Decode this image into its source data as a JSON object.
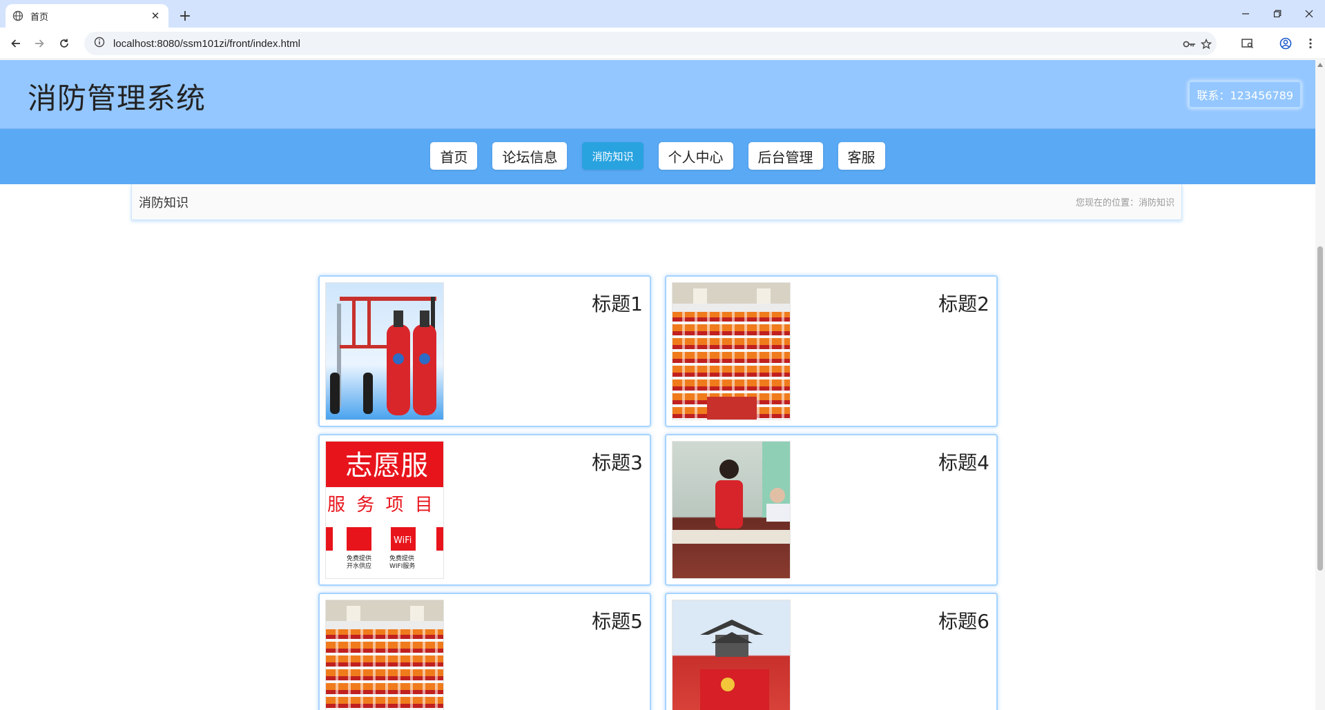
{
  "browser": {
    "tab_title": "首页",
    "url": "localhost:8080/ssm101zi/front/index.html"
  },
  "site": {
    "title": "消防管理系统",
    "contact": "联系：123456789"
  },
  "nav": {
    "items": [
      {
        "label": "首页",
        "active": false
      },
      {
        "label": "论坛信息",
        "active": false
      },
      {
        "label": "消防知识",
        "active": true
      },
      {
        "label": "个人中心",
        "active": false
      },
      {
        "label": "后台管理",
        "active": false
      },
      {
        "label": "客服",
        "active": false
      }
    ]
  },
  "breadcrumb": {
    "title": "消防知识",
    "location": "您现在的位置：消防知识"
  },
  "volunteer_sign": {
    "heading": "志愿服",
    "subheading": "服 务 项 目",
    "item1": "免费提供\n开水供应",
    "item2": "免费提供\nWIFI服务",
    "wifi": "WiFi"
  },
  "cards": [
    {
      "title": "标题1",
      "image": "fire-extinguisher-system"
    },
    {
      "title": "标题2",
      "image": "auditorium-volunteers"
    },
    {
      "title": "标题3",
      "image": "volunteer-service-sign"
    },
    {
      "title": "标题4",
      "image": "meeting-volunteer"
    },
    {
      "title": "标题5",
      "image": "auditorium-volunteers"
    },
    {
      "title": "标题6",
      "image": "pavilion-group-flag"
    }
  ],
  "colors": {
    "header_bg": "#94c7ff",
    "nav_bg": "#5aa9f5",
    "active_nav": "#29a3e0",
    "card_border": "#a6d3ff"
  }
}
